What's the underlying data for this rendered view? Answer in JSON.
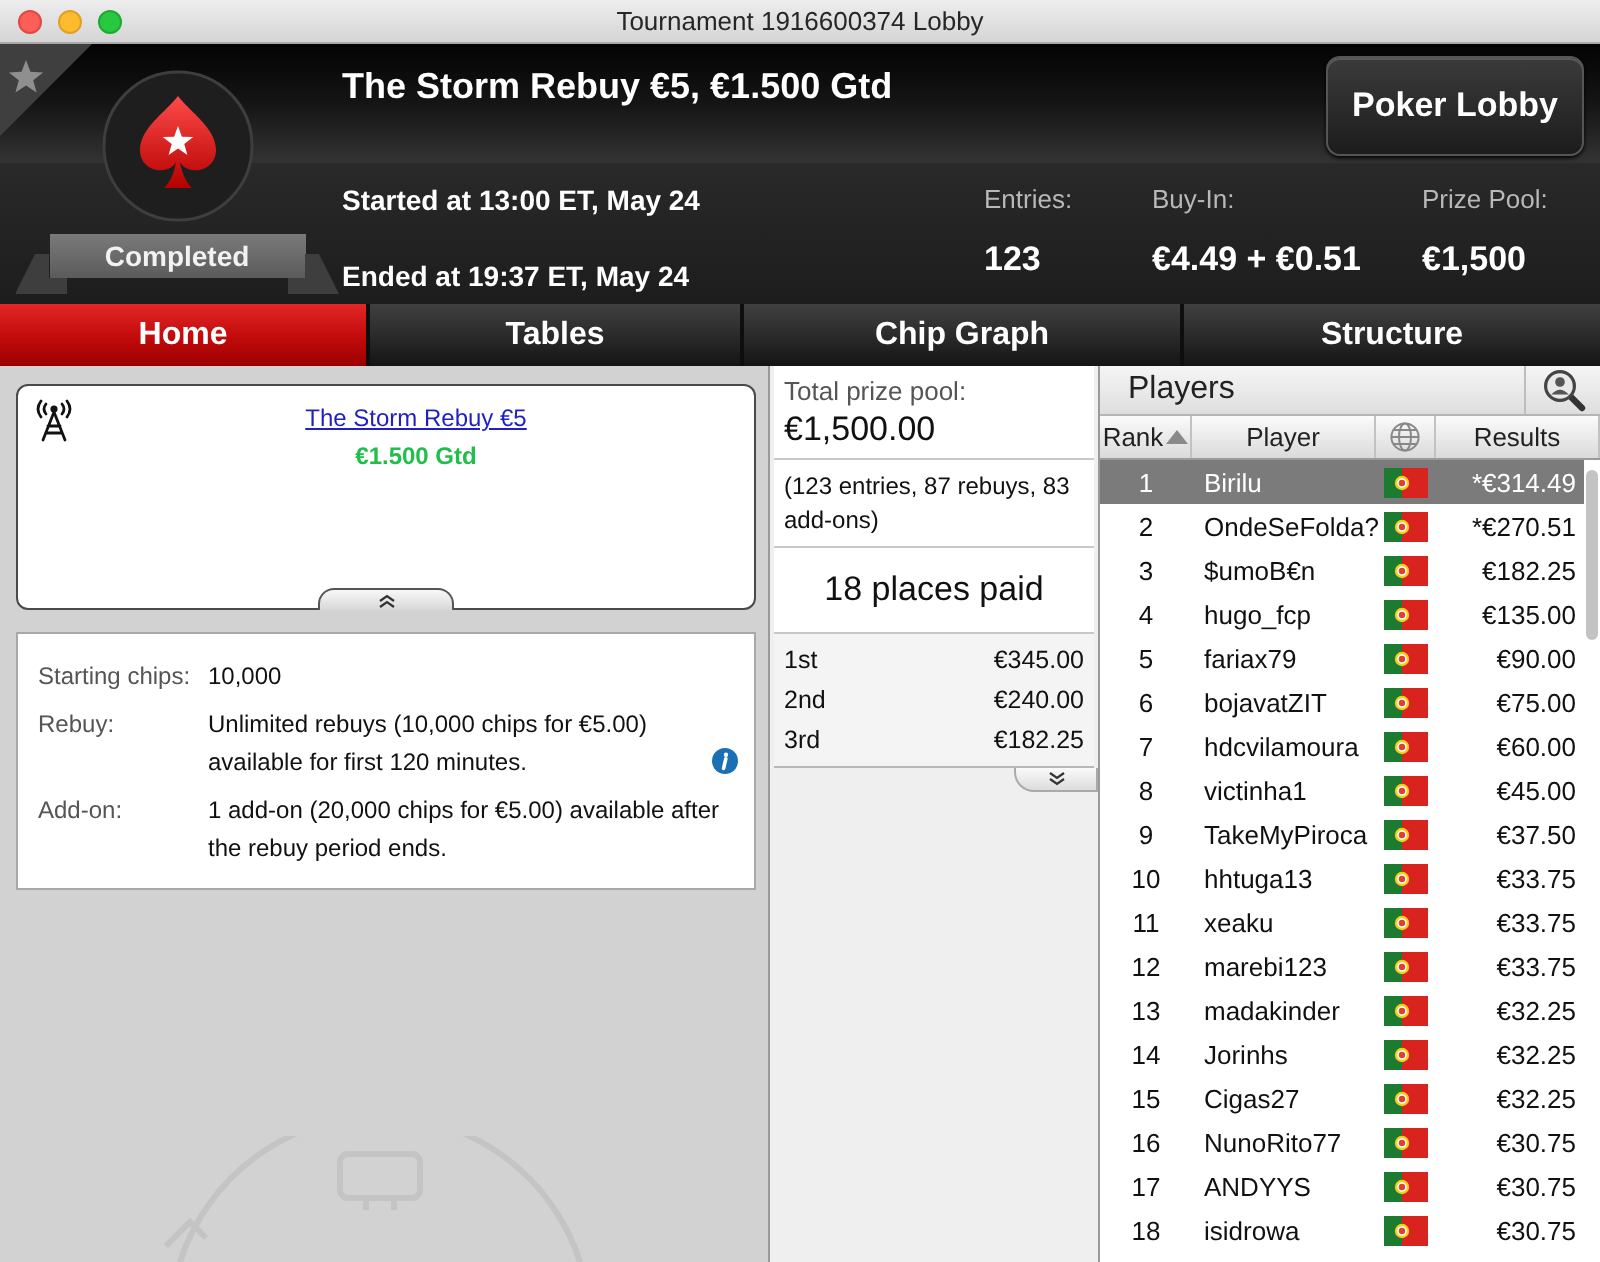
{
  "window": {
    "title": "Tournament 1916600374 Lobby"
  },
  "header": {
    "status": "Completed",
    "title": "The Storm Rebuy €5, €1.500 Gtd",
    "started": "Started at 13:00 ET, May 24",
    "ended": "Ended at 19:37 ET, May 24",
    "stats": [
      {
        "label": "Entries:",
        "value": "123"
      },
      {
        "label": "Buy-In:",
        "value": "€4.49 + €0.51"
      },
      {
        "label": "Prize Pool:",
        "value": "€1,500"
      }
    ],
    "lobby_button": "Poker Lobby"
  },
  "tabs": [
    {
      "label": "Home",
      "selected": true
    },
    {
      "label": "Tables",
      "selected": false
    },
    {
      "label": "Chip Graph",
      "selected": false
    },
    {
      "label": "Structure",
      "selected": false
    }
  ],
  "summary": {
    "link": "The Storm Rebuy €5",
    "guarantee": "€1.500 Gtd"
  },
  "details": [
    {
      "label": "Starting chips:",
      "value": "10,000",
      "info": false
    },
    {
      "label": "Rebuy:",
      "value": "Unlimited rebuys (10,000 chips for €5.00) available for first 120 minutes.",
      "info": true
    },
    {
      "label": "Add-on:",
      "value": "1 add-on (20,000 chips for €5.00) available after the rebuy period ends.",
      "info": false
    }
  ],
  "prizes": {
    "total_label": "Total prize pool:",
    "total": "€1,500.00",
    "breakdown": "(123 entries, 87 rebuys, 83 add-ons)",
    "places": "18 places paid",
    "payouts": [
      {
        "place": "1st",
        "amount": "€345.00"
      },
      {
        "place": "2nd",
        "amount": "€240.00"
      },
      {
        "place": "3rd",
        "amount": "€182.25"
      }
    ]
  },
  "players": {
    "title": "Players",
    "columns": [
      {
        "kind": "text",
        "label": "Rank",
        "sorted": true
      },
      {
        "kind": "text",
        "label": "Player",
        "sorted": false
      },
      {
        "kind": "globe",
        "sorted": false
      },
      {
        "kind": "text",
        "label": "Results",
        "sorted": false
      }
    ],
    "rows": [
      {
        "rank": "1",
        "name": "Birilu",
        "result": "*€314.49",
        "selected": true
      },
      {
        "rank": "2",
        "name": "OndeSeFolda?",
        "result": "*€270.51",
        "selected": false
      },
      {
        "rank": "3",
        "name": "$umoB€n",
        "result": "€182.25",
        "selected": false
      },
      {
        "rank": "4",
        "name": "hugo_fcp",
        "result": "€135.00",
        "selected": false
      },
      {
        "rank": "5",
        "name": "fariax79",
        "result": "€90.00",
        "selected": false
      },
      {
        "rank": "6",
        "name": "bojavatZIT",
        "result": "€75.00",
        "selected": false
      },
      {
        "rank": "7",
        "name": "hdcvilamoura",
        "result": "€60.00",
        "selected": false
      },
      {
        "rank": "8",
        "name": "victinha1",
        "result": "€45.00",
        "selected": false
      },
      {
        "rank": "9",
        "name": "TakeMyPiroca",
        "result": "€37.50",
        "selected": false
      },
      {
        "rank": "10",
        "name": "hhtuga13",
        "result": "€33.75",
        "selected": false
      },
      {
        "rank": "11",
        "name": "xeaku",
        "result": "€33.75",
        "selected": false
      },
      {
        "rank": "12",
        "name": "marebi123",
        "result": "€33.75",
        "selected": false
      },
      {
        "rank": "13",
        "name": "madakinder",
        "result": "€32.25",
        "selected": false
      },
      {
        "rank": "14",
        "name": "Jorinhs",
        "result": "€32.25",
        "selected": false
      },
      {
        "rank": "15",
        "name": "Cigas27",
        "result": "€32.25",
        "selected": false
      },
      {
        "rank": "16",
        "name": "NunoRito77",
        "result": "€30.75",
        "selected": false
      },
      {
        "rank": "17",
        "name": "ANDYYS",
        "result": "€30.75",
        "selected": false
      },
      {
        "rank": "18",
        "name": "isidrowa",
        "result": "€30.75",
        "selected": false
      }
    ]
  }
}
